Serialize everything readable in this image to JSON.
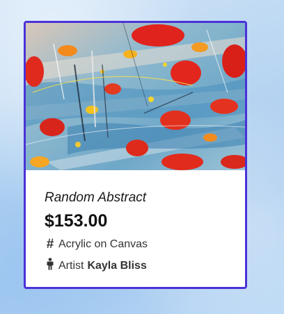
{
  "product": {
    "title": "Random Abstract",
    "price": "$153.00",
    "medium": "Acrylic on Canvas",
    "artist_label": "Artist",
    "artist_name": "Kayla Bliss",
    "image_subject": "abstract painting with red, orange, yellow and blue splashes"
  },
  "icons": {
    "medium": "hash-icon",
    "artist": "person-icon"
  },
  "colors": {
    "card_border": "#4a32d8",
    "page_background": "#b6d4f1"
  }
}
